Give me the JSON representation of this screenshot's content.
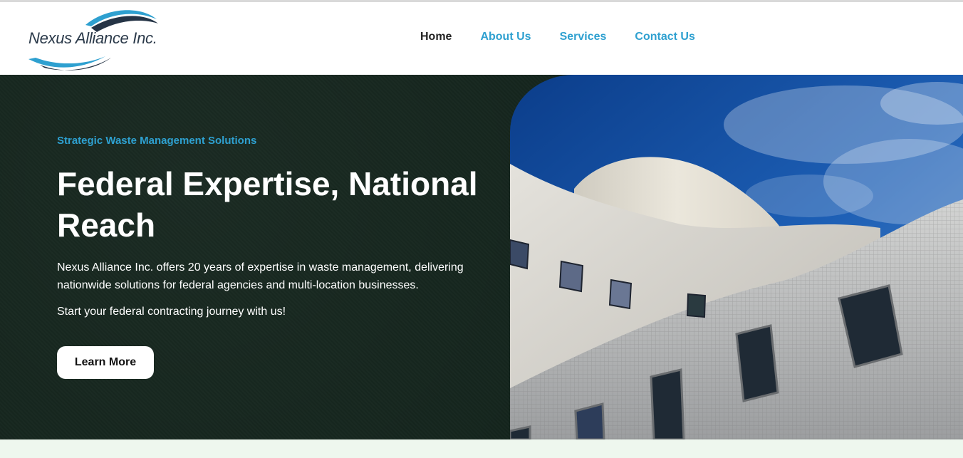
{
  "brand": {
    "name": "Nexus Alliance Inc.",
    "colors": {
      "swoosh_light": "#2ea0d0",
      "swoosh_dark": "#253446"
    }
  },
  "nav": {
    "items": [
      {
        "label": "Home",
        "active": true
      },
      {
        "label": "About Us",
        "active": false
      },
      {
        "label": "Services",
        "active": false
      },
      {
        "label": "Contact Us",
        "active": false
      }
    ]
  },
  "hero": {
    "kicker": "Strategic Waste Management Solutions",
    "headline": "Federal Expertise, National Reach",
    "paragraph": "Nexus Alliance Inc. offers 20 years of expertise in waste management, delivering nationwide solutions for federal agencies and multi-location businesses.",
    "cta_text": "Start your federal contracting journey with us!",
    "button_label": "Learn More",
    "image_subject": "white curved modern building against blue sky",
    "colors": {
      "background": "#13241c",
      "accent": "#2ea0d0"
    }
  }
}
